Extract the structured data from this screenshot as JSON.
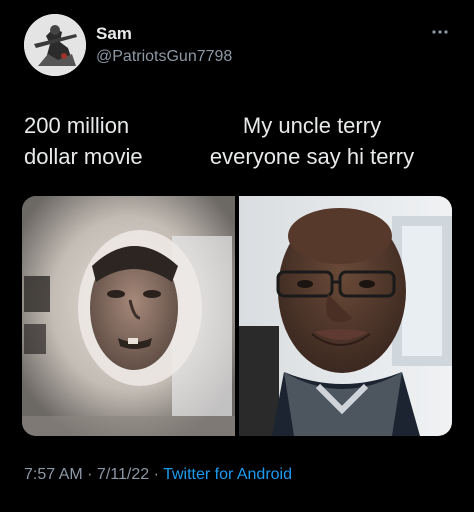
{
  "author": {
    "name": "Sam",
    "handle": "@PatriotsGun7798",
    "avatar_icon": "soldier-avatar-icon"
  },
  "more_icon": "more-options-icon",
  "tweet": {
    "caption_left_line1": "200 million",
    "caption_left_line2": "dollar movie",
    "caption_right_line1": "My uncle terry",
    "caption_right_line2": "everyone say hi terry"
  },
  "media": {
    "left_image": "boy-face-photo",
    "right_image": "man-with-glasses-photo"
  },
  "meta": {
    "time": "7:57 AM",
    "separator1": " · ",
    "date": "7/11/22",
    "separator2": " · ",
    "source": "Twitter for Android"
  },
  "colors": {
    "background": "#000000",
    "text": "#e7e9ea",
    "secondary": "#8b98a5",
    "link": "#1d9bf0"
  }
}
